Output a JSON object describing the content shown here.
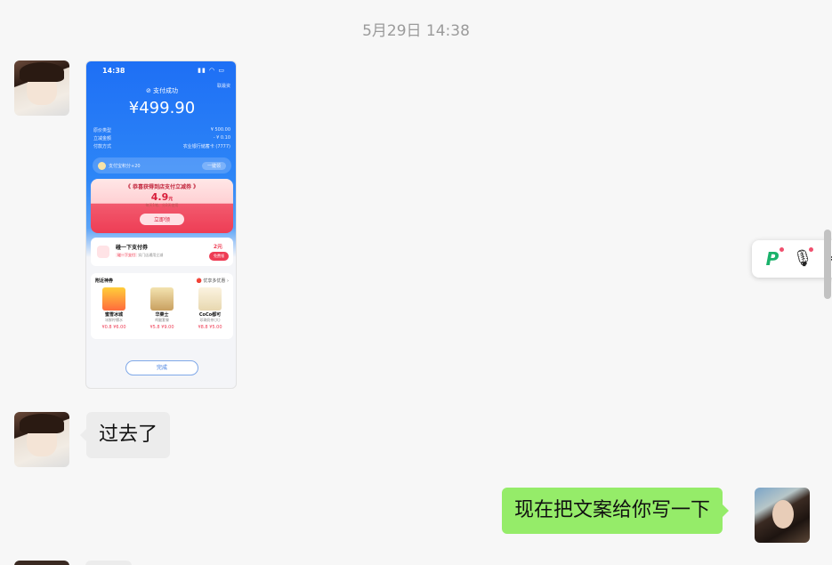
{
  "timestamp": "5月29日 14:38",
  "messages": [
    {
      "sender": "left",
      "type": "image",
      "avatar": "anime-avatar"
    },
    {
      "sender": "left",
      "type": "text",
      "text": "过去了"
    },
    {
      "sender": "right",
      "type": "text",
      "text": "现在把文案给你写一下"
    }
  ],
  "screenshot": {
    "status_time": "14:38",
    "status_icons": "▮▮ ◠ ▭",
    "paid_label": "⊘ 支付成功",
    "report_label": "联最资",
    "amount": "¥499.90",
    "rows": [
      {
        "k": "原价类型",
        "v": "¥ 500.00"
      },
      {
        "k": "立减金额",
        "v": "- ¥ 0.10"
      },
      {
        "k": "付款方式",
        "v": "农业银行储蓄卡 (7777)"
      }
    ],
    "points_text": "支付宝积分+20",
    "points_button": "一键领",
    "coupon_title": "《 恭喜获得到店支付立减券 》",
    "coupon_amount": "4.9",
    "coupon_unit": "元",
    "coupon_note": "每天1笔、分2天使用",
    "coupon_button": "立即领",
    "card2_title": "碰一下支付券",
    "card2_tag": "碰一下支付",
    "card2_sub": "实门店通用立减",
    "card2_amount": "2元",
    "card2_button": "免费领",
    "nearby_title": "附近神券",
    "nearby_more": "🔴 优享多优惠 ›",
    "items": [
      {
        "name": "蜜雪冰城",
        "desc": "冰鲜柠檬水",
        "price": "¥0.8 ¥6.00"
      },
      {
        "name": "华莱士",
        "desc": "鸡腿套餐",
        "price": "¥5.8 ¥9.00"
      },
      {
        "name": "CoCo都可",
        "desc": "珍珠奶茶(大)",
        "price": "¥8.8 ¥5.00"
      }
    ],
    "done_button": "完成"
  },
  "colors": {
    "chat_bg": "#f7f7f7",
    "bubble_left": "#ececec",
    "bubble_right": "#95ec69",
    "alipay_blue": "#1e6ff5",
    "coupon_red": "#ee3d55"
  },
  "float_bar": {
    "icons": [
      "ai-p-icon",
      "microphone-icon",
      "share-icon"
    ],
    "p_glyph": "P",
    "mic_glyph": "🎙",
    "share_glyph": "<"
  }
}
